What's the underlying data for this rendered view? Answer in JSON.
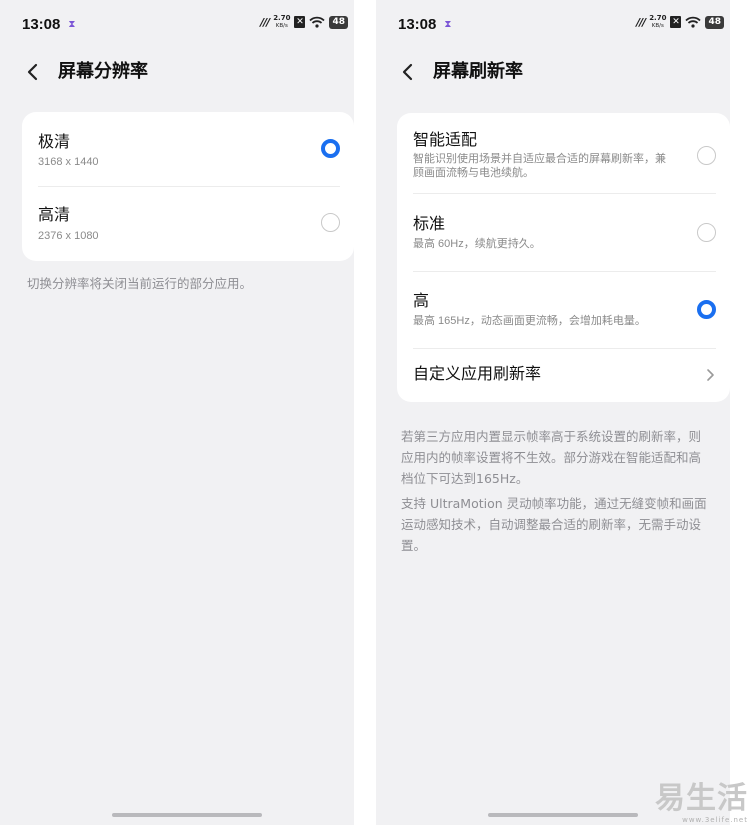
{
  "status": {
    "time": "13:08",
    "speed_value": "2.70",
    "speed_unit": "KB/s",
    "battery": "48",
    "signal_label": "ııı"
  },
  "left": {
    "title": "屏幕分辨率",
    "options": [
      {
        "label": "极清",
        "sub": "3168 x 1440",
        "selected": true
      },
      {
        "label": "高清",
        "sub": "2376 x 1080",
        "selected": false
      }
    ],
    "note": "切换分辨率将关闭当前运行的部分应用。"
  },
  "right": {
    "title": "屏幕刷新率",
    "options": [
      {
        "label": "智能适配",
        "sub_line1": "智能识别使用场景并自适应最合适的屏幕刷新率，兼",
        "sub_line2": "顾画面流畅与电池续航。",
        "selected": false
      },
      {
        "label": "标准",
        "sub": "最高 60Hz，续航更持久。",
        "selected": false
      },
      {
        "label": "高",
        "sub": "最高 165Hz，动态画面更流畅，会增加耗电量。",
        "selected": true
      }
    ],
    "custom_link": "自定义应用刷新率",
    "note1_lines": [
      "若第三方应用内置显示帧率高于系统设置的刷新率，则",
      "应用内的帧率设置将不生效。部分游戏在智能适配和高",
      "档位下可达到165Hz。"
    ],
    "note2_lines": [
      "支持 UltraMotion 灵动帧率功能，通过无缝变帧和画面",
      "运动感知技术，自动调整最合适的刷新率，无需手动设",
      "置。"
    ]
  },
  "watermark": {
    "main": "易生活",
    "sub": "www.3elife.net"
  },
  "colors": {
    "accent": "#1a6ff0",
    "background": "#f1f1f3",
    "card": "#ffffff"
  }
}
